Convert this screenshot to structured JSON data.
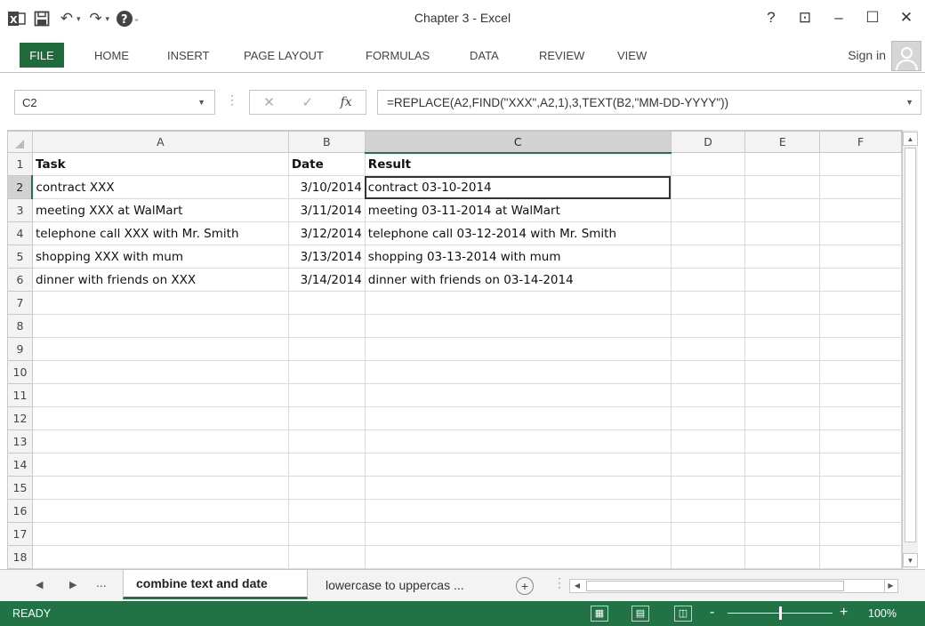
{
  "window": {
    "title": "Chapter 3 - Excel",
    "controls": [
      "?",
      "⊡",
      "–",
      "☐",
      "✕"
    ]
  },
  "ribbon": {
    "tabs": [
      "FILE",
      "HOME",
      "INSERT",
      "PAGE LAYOUT",
      "FORMULAS",
      "DATA",
      "REVIEW",
      "VIEW"
    ],
    "sign_in": "Sign in"
  },
  "formula_bar": {
    "name_box": "C2",
    "formula": "=REPLACE(A2,FIND(\"XXX\",A2,1),3,TEXT(B2,\"MM-DD-YYYY\"))"
  },
  "sheet": {
    "columns": [
      "A",
      "B",
      "C",
      "D",
      "E",
      "F"
    ],
    "active_column": "C",
    "active_row": "2",
    "rows": [
      {
        "n": "1",
        "cells": [
          "Task",
          "Date",
          "Result",
          "",
          "",
          ""
        ]
      },
      {
        "n": "2",
        "cells": [
          "contract XXX",
          "3/10/2014",
          "contract 03-10-2014",
          "",
          "",
          ""
        ]
      },
      {
        "n": "3",
        "cells": [
          "meeting XXX at WalMart",
          "3/11/2014",
          "meeting 03-11-2014 at WalMart",
          "",
          "",
          ""
        ]
      },
      {
        "n": "4",
        "cells": [
          "telephone call XXX with Mr. Smith",
          "3/12/2014",
          "telephone call 03-12-2014 with Mr. Smith",
          "",
          "",
          ""
        ]
      },
      {
        "n": "5",
        "cells": [
          "shopping XXX with mum",
          "3/13/2014",
          "shopping 03-13-2014 with mum",
          "",
          "",
          ""
        ]
      },
      {
        "n": "6",
        "cells": [
          "dinner with friends on XXX",
          "3/14/2014",
          "dinner with friends on 03-14-2014",
          "",
          "",
          ""
        ]
      },
      {
        "n": "7",
        "cells": [
          "",
          "",
          "",
          "",
          "",
          ""
        ]
      },
      {
        "n": "8",
        "cells": [
          "",
          "",
          "",
          "",
          "",
          ""
        ]
      },
      {
        "n": "9",
        "cells": [
          "",
          "",
          "",
          "",
          "",
          ""
        ]
      },
      {
        "n": "10",
        "cells": [
          "",
          "",
          "",
          "",
          "",
          ""
        ]
      },
      {
        "n": "11",
        "cells": [
          "",
          "",
          "",
          "",
          "",
          ""
        ]
      },
      {
        "n": "12",
        "cells": [
          "",
          "",
          "",
          "",
          "",
          ""
        ]
      },
      {
        "n": "13",
        "cells": [
          "",
          "",
          "",
          "",
          "",
          ""
        ]
      },
      {
        "n": "14",
        "cells": [
          "",
          "",
          "",
          "",
          "",
          ""
        ]
      },
      {
        "n": "15",
        "cells": [
          "",
          "",
          "",
          "",
          "",
          ""
        ]
      },
      {
        "n": "16",
        "cells": [
          "",
          "",
          "",
          "",
          "",
          ""
        ]
      },
      {
        "n": "17",
        "cells": [
          "",
          "",
          "",
          "",
          "",
          ""
        ]
      },
      {
        "n": "18",
        "cells": [
          "",
          "",
          "",
          "",
          "",
          ""
        ]
      }
    ]
  },
  "sheet_tabs": {
    "overflow": "...",
    "active": "combine text and date",
    "next": "lowercase to uppercas ...",
    "add": "+"
  },
  "status": {
    "mode": "READY",
    "zoom": "100%",
    "zoom_minus": "-",
    "zoom_plus": "+"
  },
  "colors": {
    "accent": "#217346",
    "file_tab": "#1f6b3c"
  }
}
